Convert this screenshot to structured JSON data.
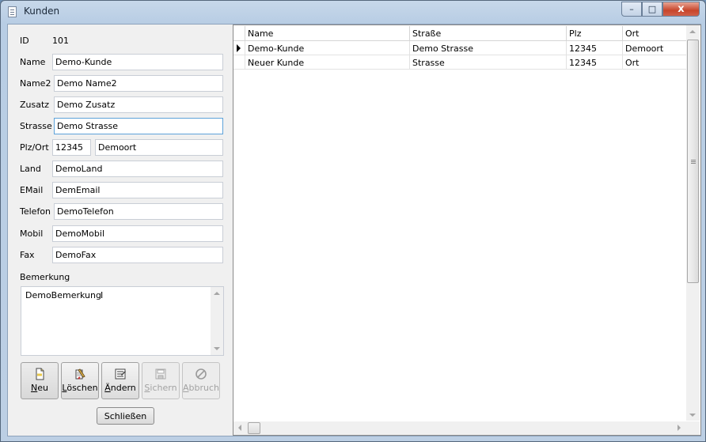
{
  "window": {
    "title": "Kunden",
    "minimize_glyph": "–",
    "maximize_glyph": "□",
    "close_glyph": "x"
  },
  "form": {
    "id_label": "ID",
    "id_value": "101",
    "name_label": "Name",
    "name_value": "Demo-Kunde",
    "name2_label": "Name2",
    "name2_value": "Demo Name2",
    "zusatz_label": "Zusatz",
    "zusatz_value": "Demo Zusatz",
    "strasse_label": "Strasse",
    "strasse_value": "Demo Strasse",
    "plzort_label": "Plz/Ort",
    "plz_value": "12345",
    "ort_value": "Demoort",
    "land_label": "Land",
    "land_value": "DemoLand",
    "email_label": "EMail",
    "email_value": "DemEmail",
    "telefon_label": "Telefon",
    "telefon_value": "DemoTelefon",
    "mobil_label": "Mobil",
    "mobil_value": "DemoMobil",
    "fax_label": "Fax",
    "fax_value": "DemoFax",
    "bemerkung_label": "Bemerkung",
    "bemerkung_value": "DemoBemerkung",
    "text_cursor": "I"
  },
  "toolbar": {
    "neu": {
      "first": "N",
      "rest": "eu",
      "enabled": true
    },
    "loeschen": {
      "first": "L",
      "rest": "öschen",
      "enabled": true
    },
    "aendern": {
      "first": "Ä",
      "rest": "ndern",
      "enabled": true
    },
    "sichern": {
      "first": "S",
      "rest": "ichern",
      "enabled": false
    },
    "abbruch": {
      "first": "A",
      "rest": "bbruch",
      "enabled": false
    },
    "schliessen_label": "Schließen"
  },
  "grid": {
    "columns": [
      "Name",
      "Straße",
      "Plz",
      "Ort"
    ],
    "rows": [
      {
        "name": "Demo-Kunde",
        "strasse": "Demo Strasse",
        "plz": "12345",
        "ort": "Demoort",
        "current": true
      },
      {
        "name": "Neuer Kunde",
        "strasse": "Strasse",
        "plz": "12345",
        "ort": "Ort",
        "current": false
      }
    ]
  },
  "colors": {
    "focus_border": "#5ea3da",
    "close_button": "#c7452b",
    "title_bar": "#c7d8ea"
  }
}
